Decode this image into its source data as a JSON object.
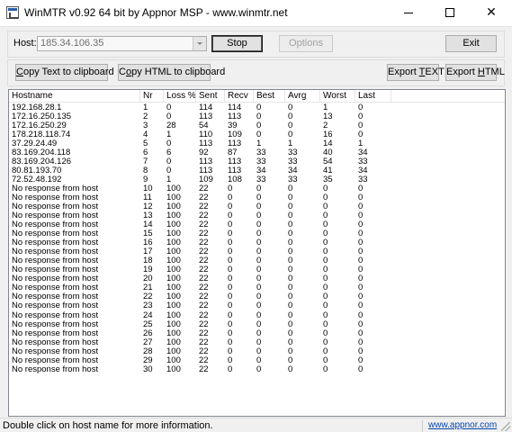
{
  "window": {
    "title": "WinMTR v0.92 64 bit by Appnor MSP - www.winmtr.net",
    "minimize": "",
    "maximize": "",
    "close": "✕"
  },
  "host_bar": {
    "label": "Host:",
    "value": "185.34.106.35",
    "stop_label": "Stop",
    "options_label": "Options",
    "exit_label": "Exit"
  },
  "toolbar": {
    "copy_text": {
      "accel": "C",
      "rest": "opy Text to clipboard"
    },
    "copy_html": {
      "pre": "C",
      "accel": "o",
      "rest": "py HTML to clipboard"
    },
    "export_text": {
      "pre": "Export ",
      "accel": "T",
      "rest": "EXT"
    },
    "export_html": {
      "pre": "Export ",
      "accel": "H",
      "rest": "TML"
    }
  },
  "table": {
    "columns": [
      "Hostname",
      "Nr",
      "Loss %",
      "Sent",
      "Recv",
      "Best",
      "Avrg",
      "Worst",
      "Last"
    ],
    "rows": [
      [
        "192.168.28.1",
        "1",
        "0",
        "114",
        "114",
        "0",
        "0",
        "1",
        "0"
      ],
      [
        "172.16.250.135",
        "2",
        "0",
        "113",
        "113",
        "0",
        "0",
        "13",
        "0"
      ],
      [
        "172.16.250.29",
        "3",
        "28",
        "54",
        "39",
        "0",
        "0",
        "2",
        "0"
      ],
      [
        "178.218.118.74",
        "4",
        "1",
        "110",
        "109",
        "0",
        "0",
        "16",
        "0"
      ],
      [
        "37.29.24.49",
        "5",
        "0",
        "113",
        "113",
        "1",
        "1",
        "14",
        "1"
      ],
      [
        "83.169.204.118",
        "6",
        "6",
        "92",
        "87",
        "33",
        "33",
        "40",
        "34"
      ],
      [
        "83.169.204.126",
        "7",
        "0",
        "113",
        "113",
        "33",
        "33",
        "54",
        "33"
      ],
      [
        "80.81.193.70",
        "8",
        "0",
        "113",
        "113",
        "34",
        "34",
        "41",
        "34"
      ],
      [
        "72.52.48.192",
        "9",
        "1",
        "109",
        "108",
        "33",
        "33",
        "35",
        "33"
      ],
      [
        "No response from host",
        "10",
        "100",
        "22",
        "0",
        "0",
        "0",
        "0",
        "0"
      ],
      [
        "No response from host",
        "11",
        "100",
        "22",
        "0",
        "0",
        "0",
        "0",
        "0"
      ],
      [
        "No response from host",
        "12",
        "100",
        "22",
        "0",
        "0",
        "0",
        "0",
        "0"
      ],
      [
        "No response from host",
        "13",
        "100",
        "22",
        "0",
        "0",
        "0",
        "0",
        "0"
      ],
      [
        "No response from host",
        "14",
        "100",
        "22",
        "0",
        "0",
        "0",
        "0",
        "0"
      ],
      [
        "No response from host",
        "15",
        "100",
        "22",
        "0",
        "0",
        "0",
        "0",
        "0"
      ],
      [
        "No response from host",
        "16",
        "100",
        "22",
        "0",
        "0",
        "0",
        "0",
        "0"
      ],
      [
        "No response from host",
        "17",
        "100",
        "22",
        "0",
        "0",
        "0",
        "0",
        "0"
      ],
      [
        "No response from host",
        "18",
        "100",
        "22",
        "0",
        "0",
        "0",
        "0",
        "0"
      ],
      [
        "No response from host",
        "19",
        "100",
        "22",
        "0",
        "0",
        "0",
        "0",
        "0"
      ],
      [
        "No response from host",
        "20",
        "100",
        "22",
        "0",
        "0",
        "0",
        "0",
        "0"
      ],
      [
        "No response from host",
        "21",
        "100",
        "22",
        "0",
        "0",
        "0",
        "0",
        "0"
      ],
      [
        "No response from host",
        "22",
        "100",
        "22",
        "0",
        "0",
        "0",
        "0",
        "0"
      ],
      [
        "No response from host",
        "23",
        "100",
        "22",
        "0",
        "0",
        "0",
        "0",
        "0"
      ],
      [
        "No response from host",
        "24",
        "100",
        "22",
        "0",
        "0",
        "0",
        "0",
        "0"
      ],
      [
        "No response from host",
        "25",
        "100",
        "22",
        "0",
        "0",
        "0",
        "0",
        "0"
      ],
      [
        "No response from host",
        "26",
        "100",
        "22",
        "0",
        "0",
        "0",
        "0",
        "0"
      ],
      [
        "No response from host",
        "27",
        "100",
        "22",
        "0",
        "0",
        "0",
        "0",
        "0"
      ],
      [
        "No response from host",
        "28",
        "100",
        "22",
        "0",
        "0",
        "0",
        "0",
        "0"
      ],
      [
        "No response from host",
        "29",
        "100",
        "22",
        "0",
        "0",
        "0",
        "0",
        "0"
      ],
      [
        "No response from host",
        "30",
        "100",
        "22",
        "0",
        "0",
        "0",
        "0",
        "0"
      ]
    ]
  },
  "status": {
    "text": "Double click on host name for more information.",
    "link": "www.appnor.com"
  }
}
